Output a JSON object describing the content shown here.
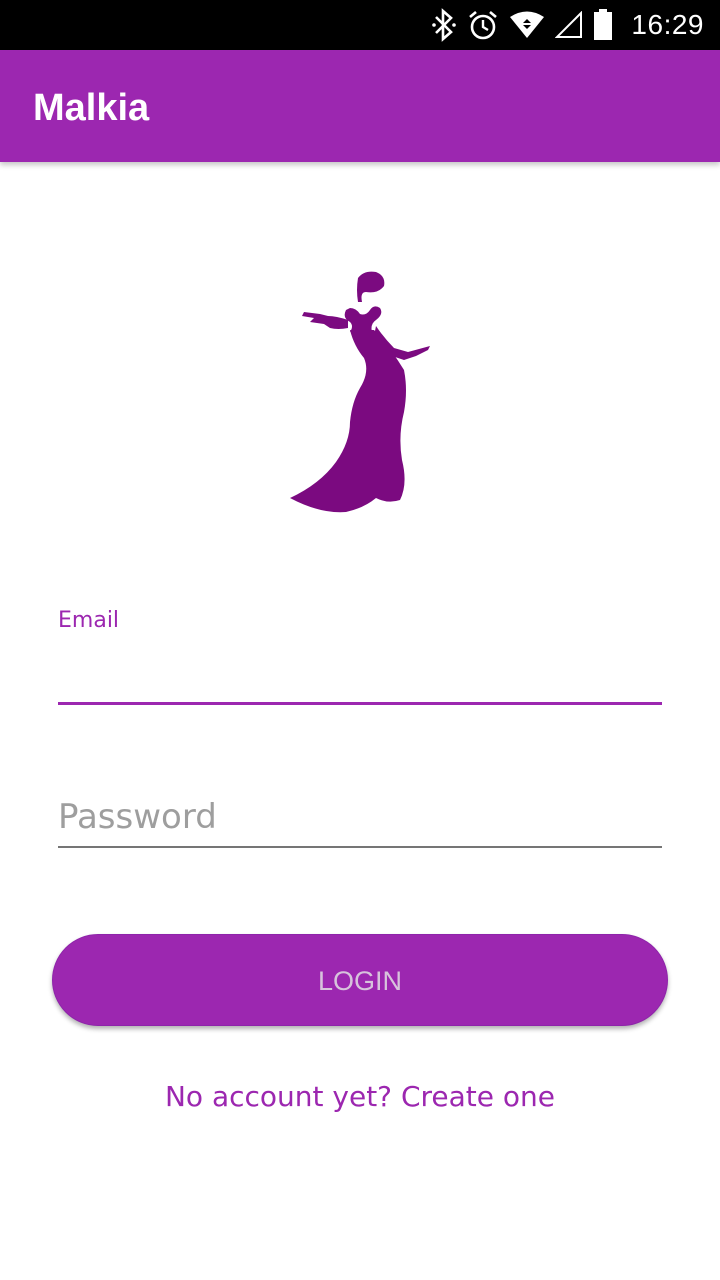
{
  "status_bar": {
    "time": "16:29",
    "icons": [
      "bluetooth-icon",
      "alarm-icon",
      "wifi-icon",
      "cell-signal-icon",
      "battery-icon"
    ]
  },
  "app_bar": {
    "title": "Malkia",
    "color": "#9c27b0"
  },
  "logo": {
    "icon": "woman-silhouette-logo",
    "color": "#7b0a80"
  },
  "form": {
    "email": {
      "label": "Email",
      "value": "",
      "placeholder": ""
    },
    "password": {
      "value": "",
      "placeholder": "Password"
    },
    "login_label": "LOGIN",
    "create_account_link": "No account yet? Create one"
  },
  "colors": {
    "accent": "#9c27b0",
    "button_text": "#d7c3dc",
    "hint": "#9e9e9e"
  }
}
